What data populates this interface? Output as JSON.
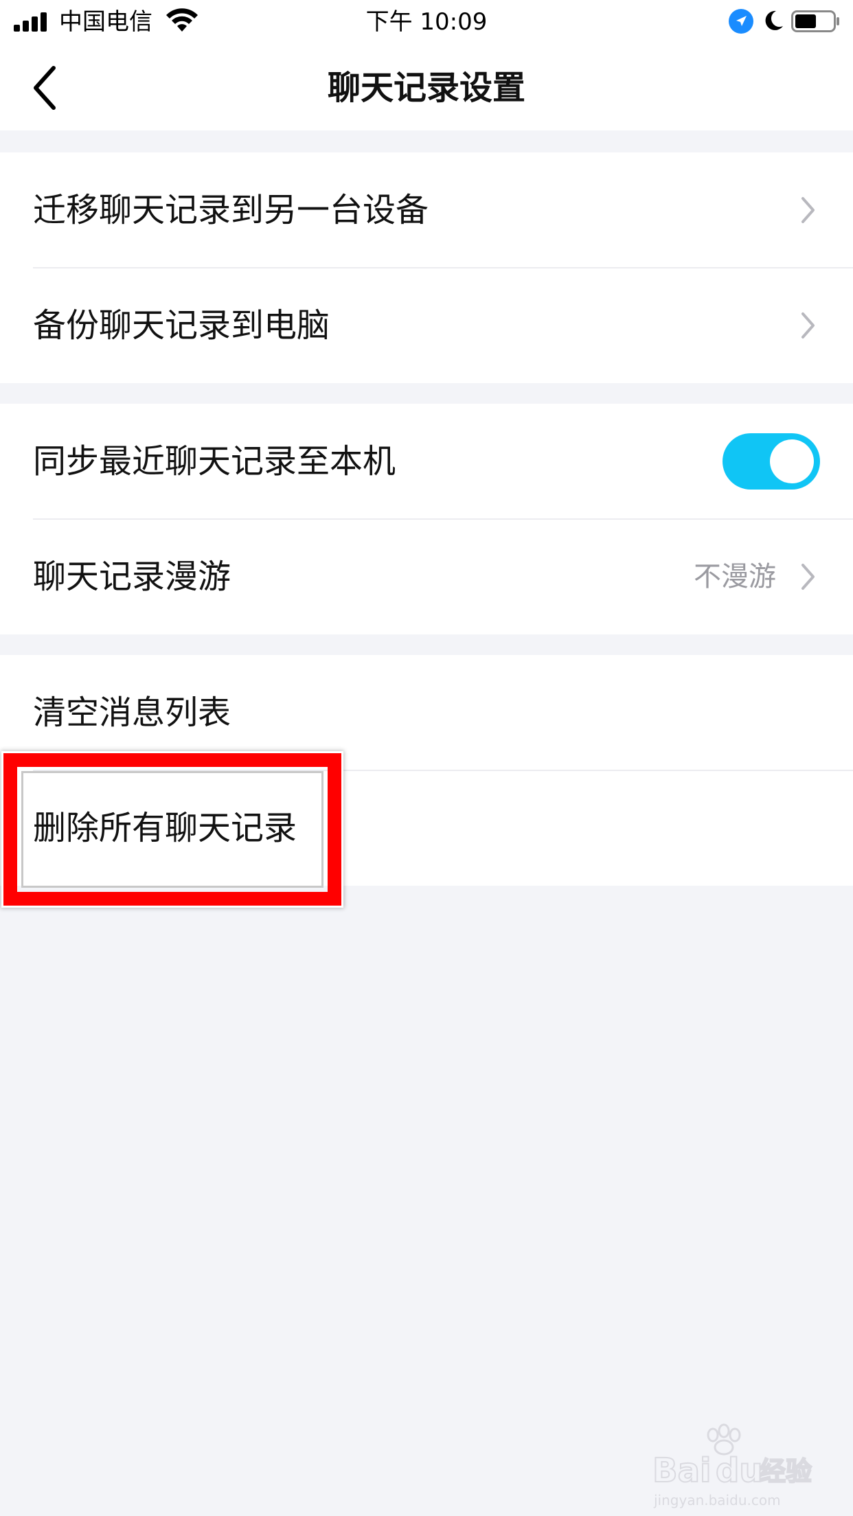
{
  "status_bar": {
    "carrier": "中国电信",
    "time": "下午 10:09",
    "icons": [
      "signal-icon",
      "wifi-icon",
      "location-icon",
      "moon-icon",
      "battery-icon"
    ]
  },
  "nav": {
    "title": "聊天记录设置",
    "back_icon": "chevron-left-icon"
  },
  "groups": [
    {
      "items": [
        {
          "label": "迁移聊天记录到另一台设备",
          "accessory": "chevron-right-icon"
        },
        {
          "label": "备份聊天记录到电脑",
          "accessory": "chevron-right-icon"
        }
      ]
    },
    {
      "items": [
        {
          "label": "同步最近聊天记录至本机",
          "accessory": "toggle",
          "toggle_on": true
        },
        {
          "label": "聊天记录漫游",
          "value": "不漫游",
          "accessory": "chevron-right-icon"
        }
      ]
    },
    {
      "items": [
        {
          "label": "清空消息列表"
        },
        {
          "label": "删除所有聊天记录",
          "highlighted": true
        }
      ]
    }
  ],
  "colors": {
    "toggle_on": "#10c5f5",
    "highlight": "#ff0000",
    "background": "#f3f4f8",
    "secondary_text": "#9a9aa0"
  },
  "watermark": {
    "logo_text": "Bai du 经验",
    "sub_text": "jingyan.baidu.com"
  }
}
